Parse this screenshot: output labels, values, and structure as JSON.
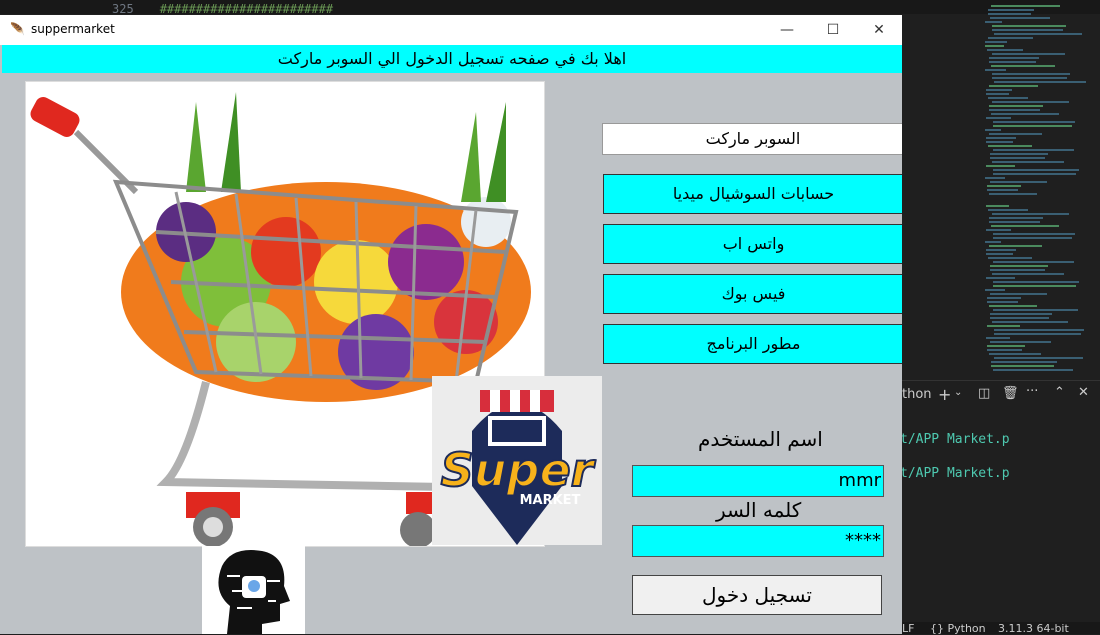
{
  "editor": {
    "line_number": "325",
    "line_text": "########################",
    "terminal_lines": [
      "t/APP Market.p",
      "t/APP Market.p"
    ],
    "terminal_tab": "thon",
    "status_items": [
      "LF",
      "{} Python",
      "3.11.3 64-bit"
    ]
  },
  "window": {
    "title": "suppermarket",
    "minimize_label": "—",
    "maximize_label": "☐",
    "close_label": "✕"
  },
  "banner": {
    "text": "اهلا بك في صفحه تسجيل الدخول الي السوبر ماركت"
  },
  "images": {
    "cart": "shopping-cart-with-vegetables",
    "logo": "Super Market",
    "logo_word1": "Super",
    "logo_word2": "MARKET"
  },
  "sidebar": {
    "store_name": "السوبر ماركت",
    "buttons": [
      {
        "label": "حسابات السوشيال ميديا"
      },
      {
        "label": "واتس اب"
      },
      {
        "label": "فيس بوك"
      },
      {
        "label": "مطور البرنامج"
      }
    ]
  },
  "login": {
    "username_label": "اسم المستخدم",
    "username_value": "mmr",
    "password_label": "كلمه السر",
    "password_value": "****",
    "submit_label": "تسجيل دخول"
  },
  "colors": {
    "accent": "#00ffff",
    "window_bg": "#bec2c6",
    "editor_bg": "#1f1f1f"
  }
}
